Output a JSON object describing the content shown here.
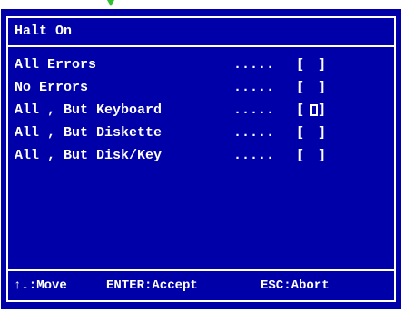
{
  "dialog": {
    "title": "Halt On",
    "options": [
      {
        "label": "All Errors",
        "dots": ".....",
        "selected": false
      },
      {
        "label": "No Errors",
        "dots": ".....",
        "selected": false
      },
      {
        "label": "All , But Keyboard",
        "dots": ".....",
        "selected": true
      },
      {
        "label": "All , But Diskette",
        "dots": ".....",
        "selected": false
      },
      {
        "label": "All , But Disk/Key",
        "dots": ".....",
        "selected": false
      }
    ],
    "bracket_open": "[",
    "bracket_close": "]",
    "footer": {
      "move": "↑↓:Move",
      "accept": "ENTER:Accept",
      "abort": "ESC:Abort"
    }
  },
  "colors": {
    "background": "#0000a8",
    "text": "#ffffff",
    "pointer": "#2fbf2f"
  }
}
